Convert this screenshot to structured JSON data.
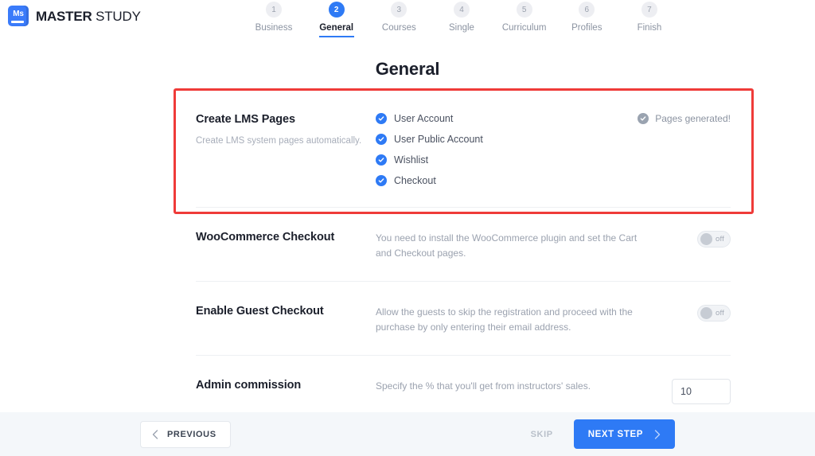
{
  "brand": {
    "mark_text": "Ms",
    "name_bold": "MASTER",
    "name_light": " STUDY"
  },
  "stepper": {
    "steps": [
      {
        "number": "1",
        "label": "Business",
        "active": false
      },
      {
        "number": "2",
        "label": "General",
        "active": true
      },
      {
        "number": "3",
        "label": "Courses",
        "active": false
      },
      {
        "number": "4",
        "label": "Single",
        "active": false
      },
      {
        "number": "5",
        "label": "Curriculum",
        "active": false
      },
      {
        "number": "6",
        "label": "Profiles",
        "active": false
      },
      {
        "number": "7",
        "label": "Finish",
        "active": false
      }
    ]
  },
  "page_title": "General",
  "rows": {
    "lms_pages": {
      "title": "Create LMS Pages",
      "subtitle": "Create LMS system pages automatically.",
      "checkboxes": [
        {
          "label": "User Account",
          "checked": true
        },
        {
          "label": "User Public Account",
          "checked": true
        },
        {
          "label": "Wishlist",
          "checked": true
        },
        {
          "label": "Checkout",
          "checked": true
        }
      ],
      "status_badge": "Pages generated!"
    },
    "woocommerce_checkout": {
      "title": "WooCommerce Checkout",
      "description": "You need to install the WooCommerce plugin and set the Cart and Checkout pages.",
      "toggle_label": "off",
      "toggle_state": "off"
    },
    "guest_checkout": {
      "title": "Enable Guest Checkout",
      "description": "Allow the guests to skip the registration and proceed with the purchase by only entering their email address.",
      "toggle_label": "off",
      "toggle_state": "off"
    },
    "admin_commission": {
      "title": "Admin commission",
      "description": "Specify the % that you'll get from instructors' sales.",
      "value": "10"
    }
  },
  "footer": {
    "previous_label": "PREVIOUS",
    "skip_label": "SKIP",
    "next_label": "NEXT STEP"
  },
  "colors": {
    "accent_blue": "#2e7af5",
    "highlight_red": "#ef3b39",
    "footer_bg": "#f4f7fa",
    "muted_text": "#9ba2af"
  }
}
